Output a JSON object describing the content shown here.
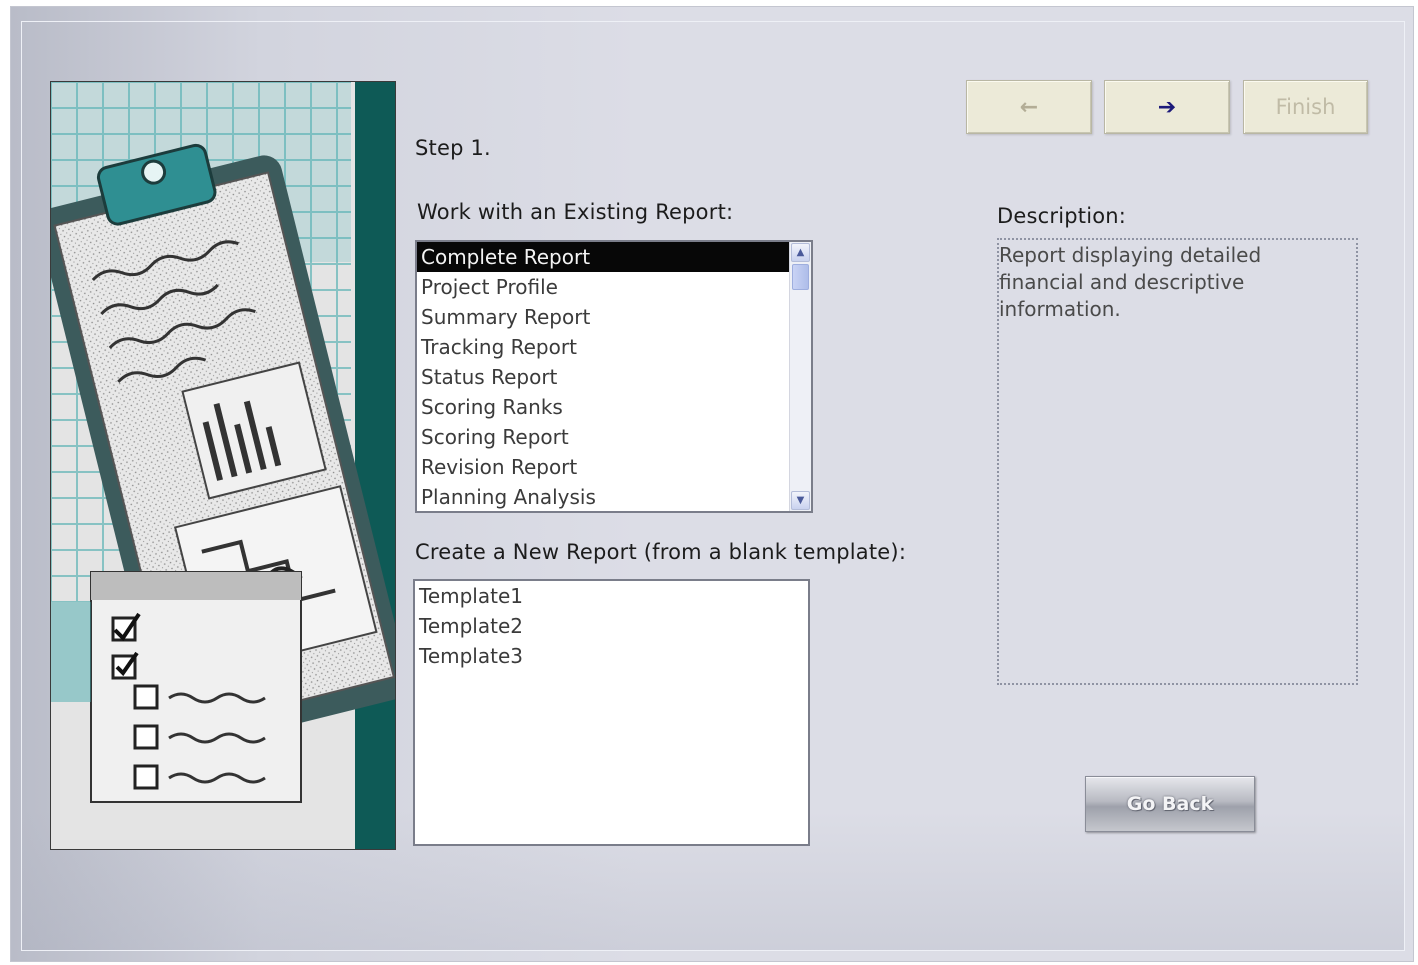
{
  "wizard": {
    "step_label": "Step 1.",
    "existing_label": "Work with an Existing Report:",
    "new_label": "Create a New Report (from a blank template):",
    "description_label": "Description:",
    "description_text": "Report displaying detailed financial and descriptive information.",
    "existing_reports": [
      {
        "label": "Complete Report",
        "selected": true
      },
      {
        "label": "Project Profile",
        "selected": false
      },
      {
        "label": "Summary Report",
        "selected": false
      },
      {
        "label": "Tracking Report",
        "selected": false
      },
      {
        "label": "Status Report",
        "selected": false
      },
      {
        "label": "Scoring Ranks",
        "selected": false
      },
      {
        "label": "Scoring Report",
        "selected": false
      },
      {
        "label": "Revision Report",
        "selected": false
      },
      {
        "label": "Planning Analysis",
        "selected": false
      }
    ],
    "templates": [
      "Template1",
      "Template2",
      "Template3"
    ]
  },
  "nav": {
    "back_icon": "left-arrow",
    "back_glyph": "←",
    "next_icon": "right-arrow",
    "next_glyph": "➔",
    "finish_label": "Finish",
    "go_back_label": "Go Back"
  },
  "colors": {
    "selected_bg": "#070707",
    "teal_accent": "#0e5a56",
    "nav_button_bg": "#ecead8"
  }
}
